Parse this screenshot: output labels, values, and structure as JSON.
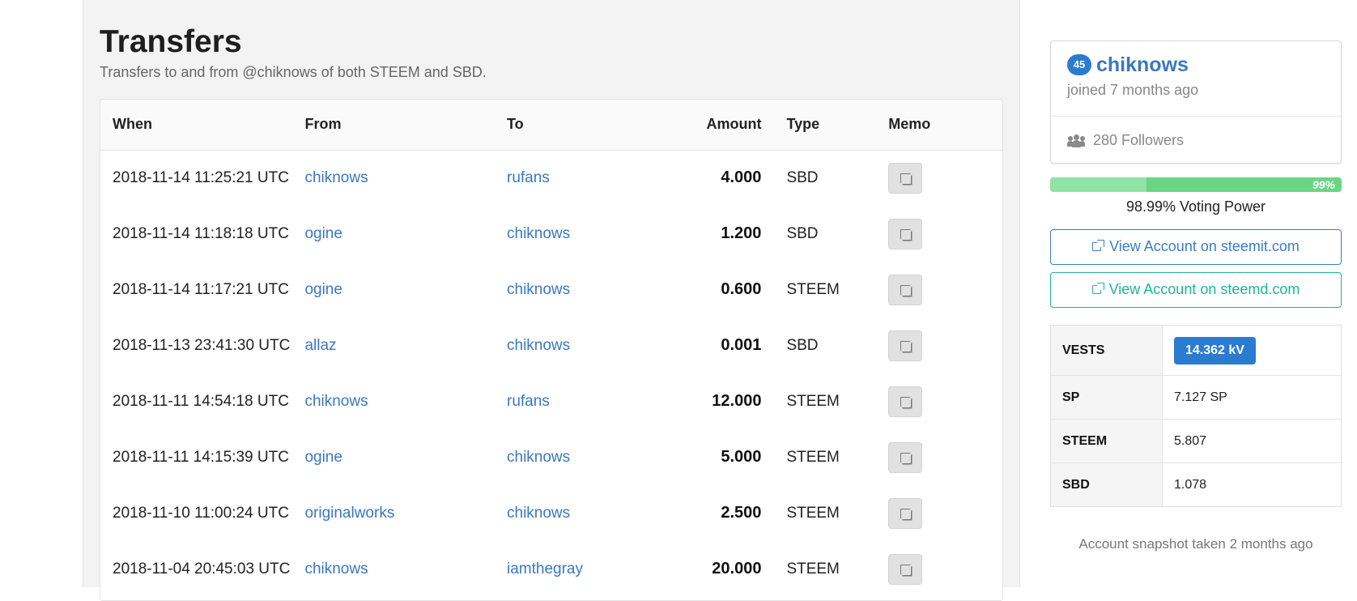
{
  "page": {
    "title": "Transfers",
    "subtitle": "Transfers to and from @chiknows of both STEEM and SBD."
  },
  "table": {
    "headers": {
      "when": "When",
      "from": "From",
      "to": "To",
      "amount": "Amount",
      "type": "Type",
      "memo": "Memo"
    },
    "rows": [
      {
        "when": "2018-11-14 11:25:21 UTC",
        "from": "chiknows",
        "to": "rufans",
        "amount": "4.000",
        "type": "SBD"
      },
      {
        "when": "2018-11-14 11:18:18 UTC",
        "from": "ogine",
        "to": "chiknows",
        "amount": "1.200",
        "type": "SBD"
      },
      {
        "when": "2018-11-14 11:17:21 UTC",
        "from": "ogine",
        "to": "chiknows",
        "amount": "0.600",
        "type": "STEEM"
      },
      {
        "when": "2018-11-13 23:41:30 UTC",
        "from": "allaz",
        "to": "chiknows",
        "amount": "0.001",
        "type": "SBD"
      },
      {
        "when": "2018-11-11 14:54:18 UTC",
        "from": "chiknows",
        "to": "rufans",
        "amount": "12.000",
        "type": "STEEM"
      },
      {
        "when": "2018-11-11 14:15:39 UTC",
        "from": "ogine",
        "to": "chiknows",
        "amount": "5.000",
        "type": "STEEM"
      },
      {
        "when": "2018-11-10 11:00:24 UTC",
        "from": "originalworks",
        "to": "chiknows",
        "amount": "2.500",
        "type": "STEEM"
      },
      {
        "when": "2018-11-04 20:45:03 UTC",
        "from": "chiknows",
        "to": "iamthegray",
        "amount": "20.000",
        "type": "STEEM"
      }
    ],
    "memo_icon": "memo-icon"
  },
  "profile": {
    "reputation": "45",
    "name": "chiknows",
    "joined": "joined 7 months ago",
    "followers": "280 Followers",
    "followers_icon": "users-icon"
  },
  "voting": {
    "fraction": 0.9899,
    "bar_label": "99%",
    "label": "98.99% Voting Power"
  },
  "links": {
    "steemit": "View Account on steemit.com",
    "steemd": "View Account on steemd.com",
    "icon": "external-link-icon"
  },
  "stats": [
    {
      "key": "VESTS",
      "value": "14.362 kV"
    },
    {
      "key": "SP",
      "value": "7.127 SP"
    },
    {
      "key": "STEEM",
      "value": "5.807"
    },
    {
      "key": "SBD",
      "value": "1.078"
    }
  ],
  "snapshot": "Account snapshot taken 2 months ago",
  "colors": {
    "link": "#3a78c0",
    "badge": "#2b7bd1",
    "voting_bar": "#6ad684",
    "steemit_button": "#3a7ec4",
    "steemd_button": "#1fb494"
  }
}
